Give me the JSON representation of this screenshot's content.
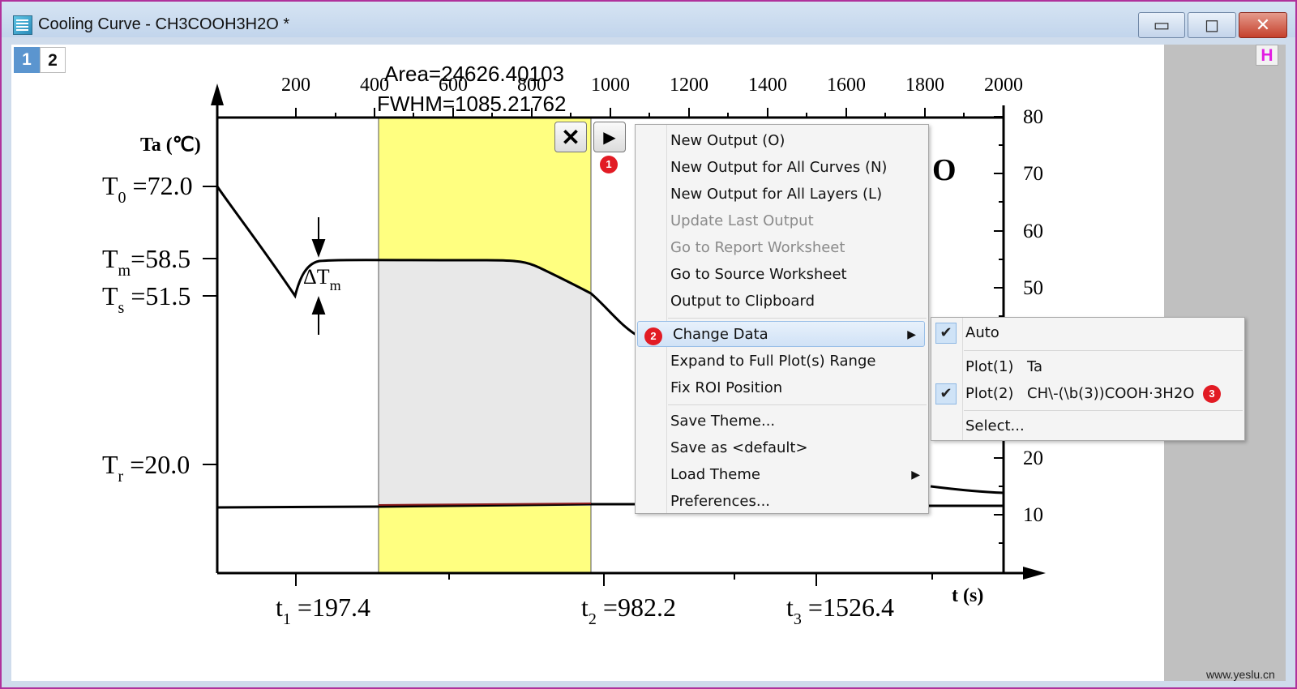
{
  "window": {
    "title": "Cooling Curve - CH3COOH3H2O *",
    "min_icon": "minimize-icon",
    "max_icon": "maximize-icon",
    "close_icon": "close-icon",
    "min_glyph": "▭",
    "max_glyph": "◻",
    "close_glyph": "✕"
  },
  "layer_tabs": [
    "1",
    "2"
  ],
  "h_button": "H",
  "watermark": "www.yeslu.cn",
  "roi": {
    "area_label": "Area=24626.40103",
    "fwhm_label": "FWHM=1085.21762",
    "close_glyph": "✕",
    "menu_glyph": "▶"
  },
  "plot": {
    "top_axis_ticks": [
      "200",
      "400",
      "600",
      "800",
      "1000",
      "1200",
      "1400",
      "1600",
      "1800",
      "2000"
    ],
    "right_axis_ticks": [
      "80",
      "70",
      "60",
      "50",
      "20",
      "10"
    ],
    "ylabel": "Ta (℃)",
    "xlabel": "t (s)",
    "partial_title": "O",
    "t0": "T",
    "t0_sub": "0",
    "t0_value": " =72.0",
    "tm": "T",
    "tm_sub": "m",
    "tm_value": "=58.5",
    "ts": "T",
    "ts_sub": "s",
    "ts_value": " =51.5",
    "tr": "T",
    "tr_sub": "r",
    "tr_value": " =20.0",
    "dtm": "ΔT",
    "dtm_sub": "m",
    "t1": "t",
    "t1_sub": "1",
    "t1_value": " =197.4",
    "t2": "t",
    "t2_sub": "2",
    "t2_value": " =982.2",
    "t3": "t",
    "t3_sub": "3",
    "t3_value": " =1526.4"
  },
  "context_menu": {
    "items": [
      {
        "label": "New Output (O)",
        "disabled": false
      },
      {
        "label": "New Output for All Curves (N)",
        "disabled": false
      },
      {
        "label": "New Output for All Layers (L)",
        "disabled": false
      },
      {
        "label": "Update Last Output",
        "disabled": true
      },
      {
        "label": "Go to Report Worksheet",
        "disabled": true
      },
      {
        "label": "Go to Source Worksheet",
        "disabled": false
      },
      {
        "label": "Output to Clipboard",
        "disabled": false
      },
      {
        "label": "Change Data",
        "disabled": false
      },
      {
        "label": "Expand to Full Plot(s) Range",
        "disabled": false
      },
      {
        "label": "Fix ROI Position",
        "disabled": false
      },
      {
        "label": "Save Theme...",
        "disabled": false
      },
      {
        "label": "Save as <default>",
        "disabled": false
      },
      {
        "label": "Load Theme",
        "disabled": false
      },
      {
        "label": "Preferences...",
        "disabled": false
      }
    ],
    "submenu_arrow": "▶"
  },
  "submenu": {
    "auto_label": "Auto",
    "auto_checked": true,
    "plot1_label": "Plot(1)",
    "plot1_name": "Ta",
    "plot1_checked": false,
    "plot2_label": "Plot(2)",
    "plot2_name": "CH\\-(\\b(3))COOH·3H2O",
    "plot2_checked": true,
    "select_label": "Select...",
    "check_glyph": "✔"
  },
  "badges": [
    "1",
    "2",
    "3"
  ],
  "colors": {
    "roi_fill": "#ffff80",
    "shade_fill": "#e8e8e8",
    "badge": "#e21b24",
    "highlight": "#d0e2f6"
  }
}
